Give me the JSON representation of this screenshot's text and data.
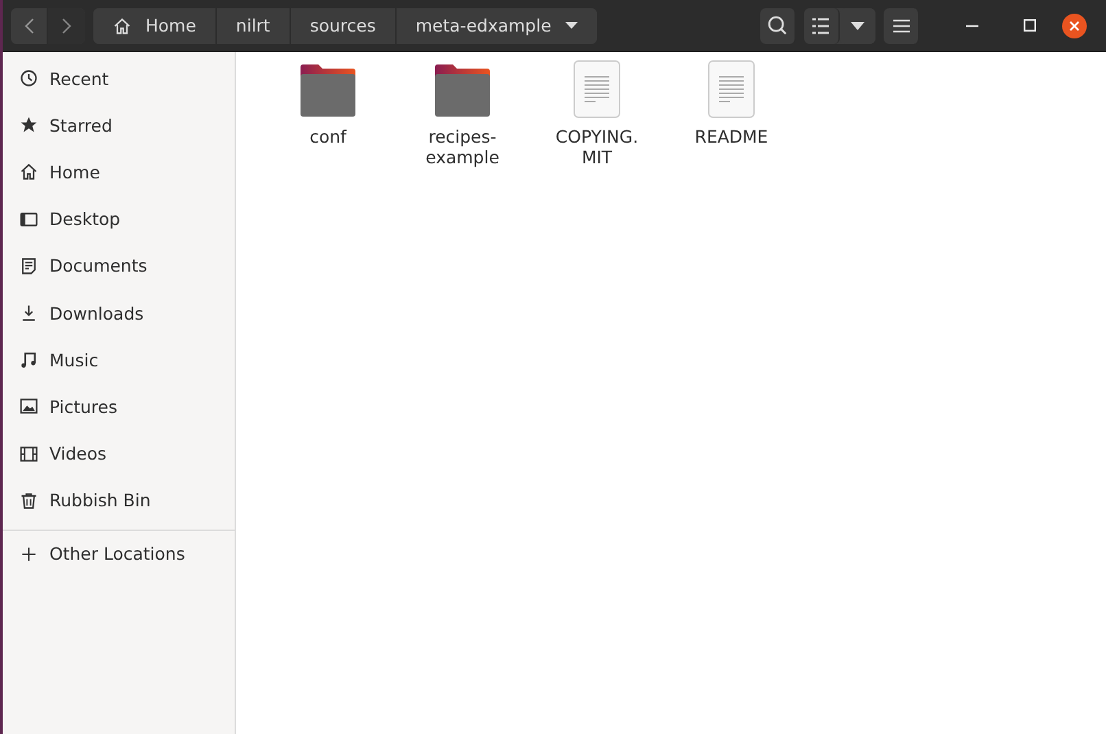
{
  "header": {
    "breadcrumbs": [
      {
        "label": "Home",
        "kind": "home"
      },
      {
        "label": "nilrt",
        "kind": "plain"
      },
      {
        "label": "sources",
        "kind": "plain"
      },
      {
        "label": "meta-edxample",
        "kind": "current"
      }
    ]
  },
  "sidebar": {
    "items": [
      {
        "label": "Recent",
        "kind": "recent"
      },
      {
        "label": "Starred",
        "kind": "star"
      },
      {
        "label": "Home",
        "kind": "home"
      },
      {
        "label": "Desktop",
        "kind": "desktop"
      },
      {
        "label": "Documents",
        "kind": "documents"
      },
      {
        "label": "Downloads",
        "kind": "downloads"
      },
      {
        "label": "Music",
        "kind": "music"
      },
      {
        "label": "Pictures",
        "kind": "pictures"
      },
      {
        "label": "Videos",
        "kind": "videos"
      },
      {
        "label": "Rubbish Bin",
        "kind": "bin"
      }
    ],
    "other": {
      "label": "Other Locations",
      "kind": "plus"
    }
  },
  "files": [
    {
      "name": "conf",
      "kind": "folder"
    },
    {
      "name": "recipes-example",
      "kind": "folder"
    },
    {
      "name": "COPYING.MIT",
      "kind": "file"
    },
    {
      "name": "README",
      "kind": "file"
    }
  ]
}
